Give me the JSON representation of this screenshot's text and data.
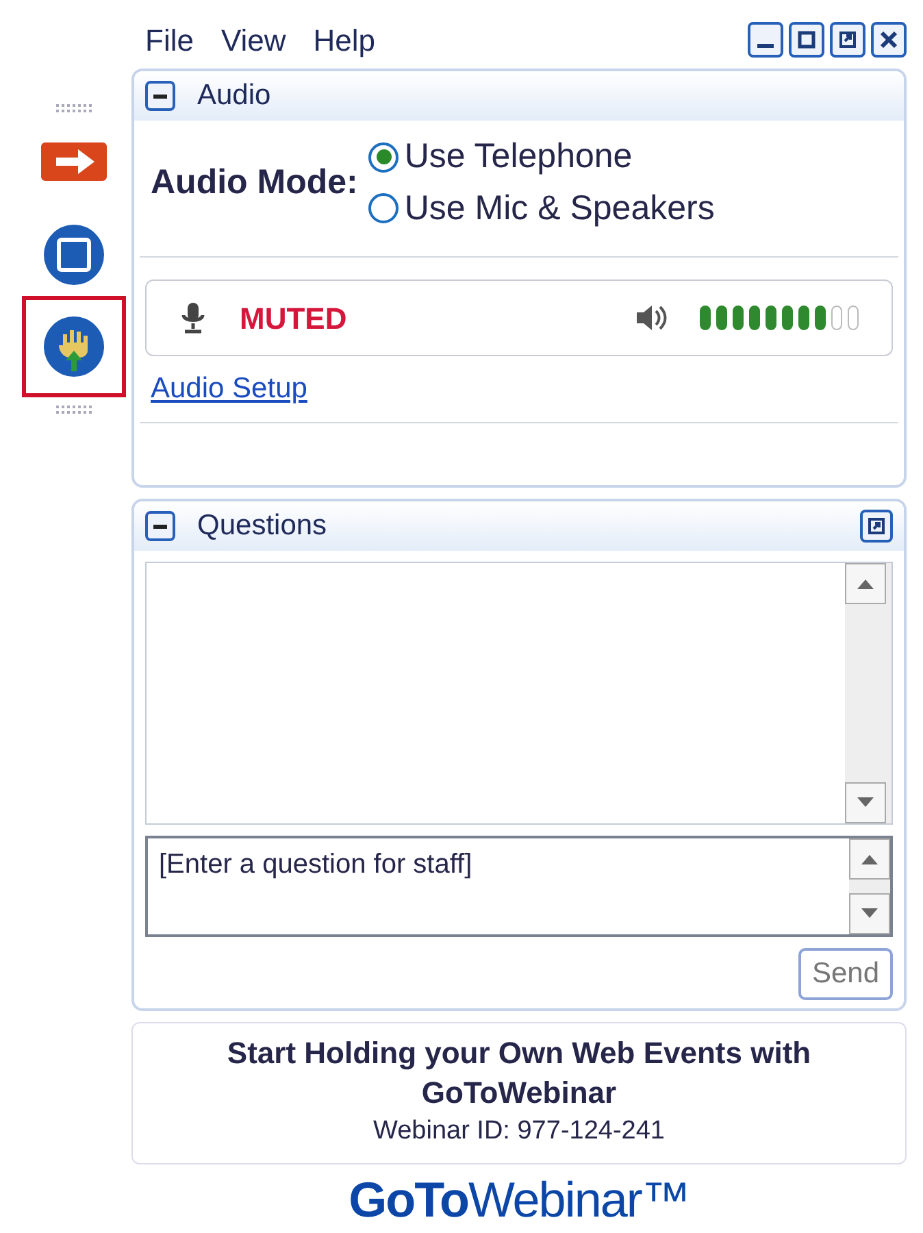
{
  "menu": [
    "File",
    "View",
    "Help"
  ],
  "window_controls": [
    {
      "kind": "minimize"
    },
    {
      "kind": "maximize"
    },
    {
      "kind": "restore"
    },
    {
      "kind": "close"
    }
  ],
  "toolbar": [
    {
      "kind": "arrow",
      "selected": false
    },
    {
      "kind": "screen",
      "selected": false
    },
    {
      "kind": "hand",
      "selected": true
    }
  ],
  "audio": {
    "title": "Audio",
    "mode_label": "Audio Mode:",
    "options": [
      {
        "label": "Use Telephone",
        "selected": true
      },
      {
        "label": "Use Mic & Speakers",
        "selected": false
      }
    ],
    "status": "MUTED",
    "speaker_meter": {
      "level": 0.8
    },
    "setup_link": "Audio Setup"
  },
  "questions": {
    "title": "Questions",
    "placeholder": "[Enter a question for staff]",
    "send": "Send"
  },
  "promo": {
    "headline": "Start Holding your Own Web Events with GoToWebinar",
    "webinar_id": "Webinar ID: 977-124-241"
  },
  "logo": "**GoTo**Webinar™"
}
